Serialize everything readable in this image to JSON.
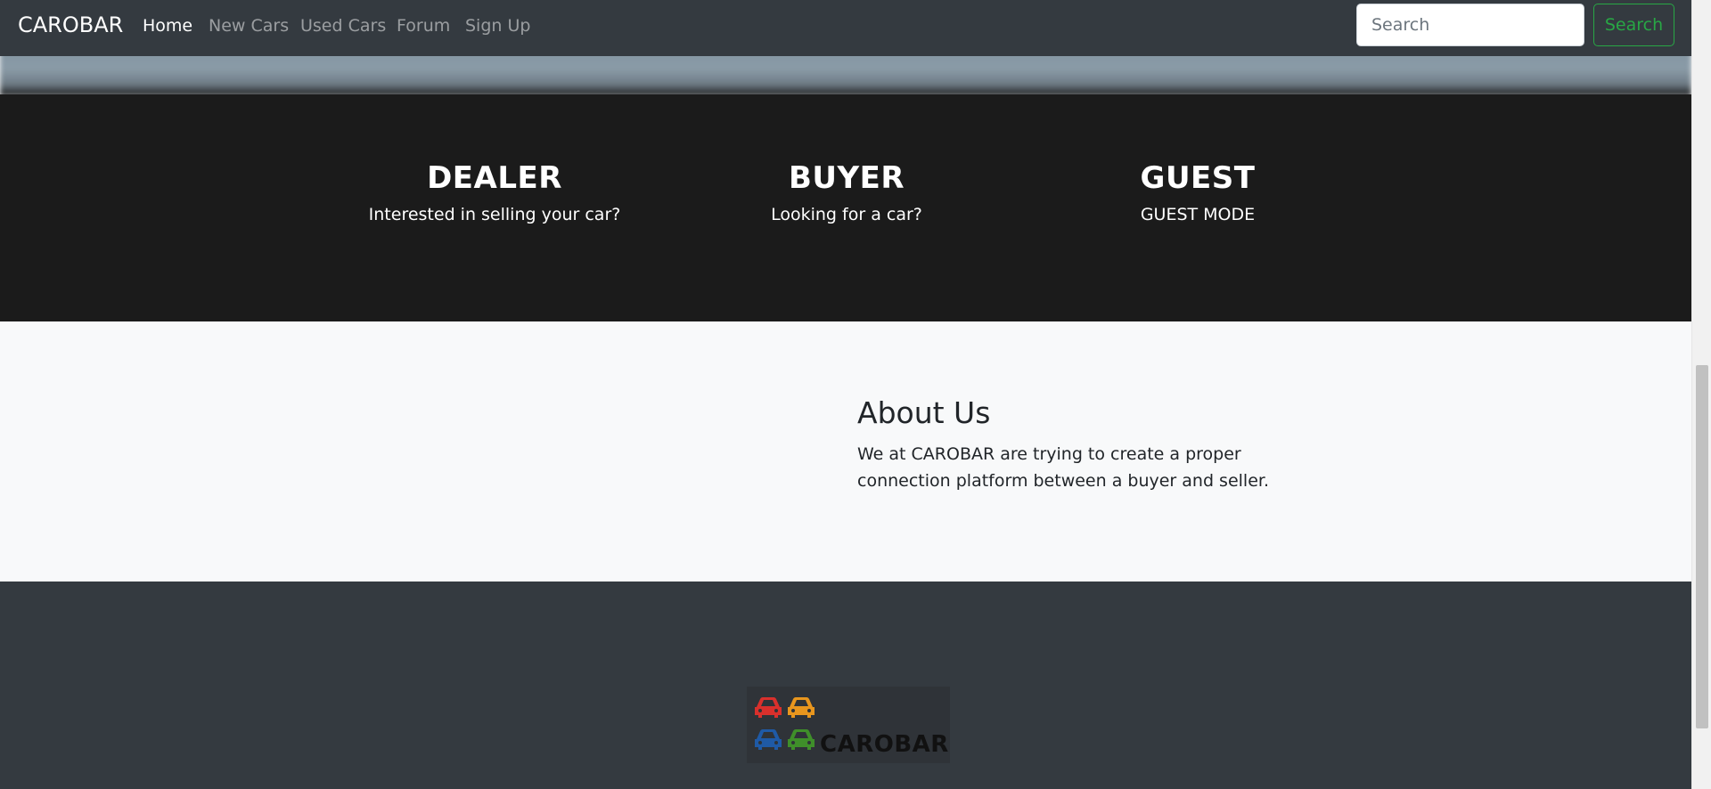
{
  "navbar": {
    "brand": "CAROBAR",
    "links": [
      {
        "label": "Home",
        "active": true
      },
      {
        "label": "New Cars",
        "active": false
      },
      {
        "label": "Used Cars",
        "active": false
      },
      {
        "label": "Forum",
        "active": false
      },
      {
        "label": "Sign Up",
        "active": false
      }
    ],
    "search": {
      "placeholder": "Search",
      "value": "",
      "button_label": "Search"
    }
  },
  "roles": [
    {
      "title": "DEALER",
      "subtitle": "Interested in selling your car?"
    },
    {
      "title": "BUYER",
      "subtitle": "Looking for a car?"
    },
    {
      "title": "GUEST",
      "subtitle": "GUEST MODE"
    }
  ],
  "about": {
    "title": "About Us",
    "text": "We at CAROBAR are trying to create a proper connection platform between a buyer and seller."
  },
  "footer": {
    "logo_text": "CAROBAR",
    "logo_icons": [
      "car-icon-red",
      "car-icon-orange",
      "car-icon-blue",
      "car-icon-green"
    ]
  },
  "colors": {
    "navbar_bg": "#343a40",
    "roles_bg": "#1b1b1b",
    "about_bg": "#f8f9fa",
    "search_button": "#28a745",
    "car_red": "#d9302c",
    "car_orange": "#e8961e",
    "car_blue": "#1f5aa6",
    "car_green": "#3f8f2a"
  }
}
